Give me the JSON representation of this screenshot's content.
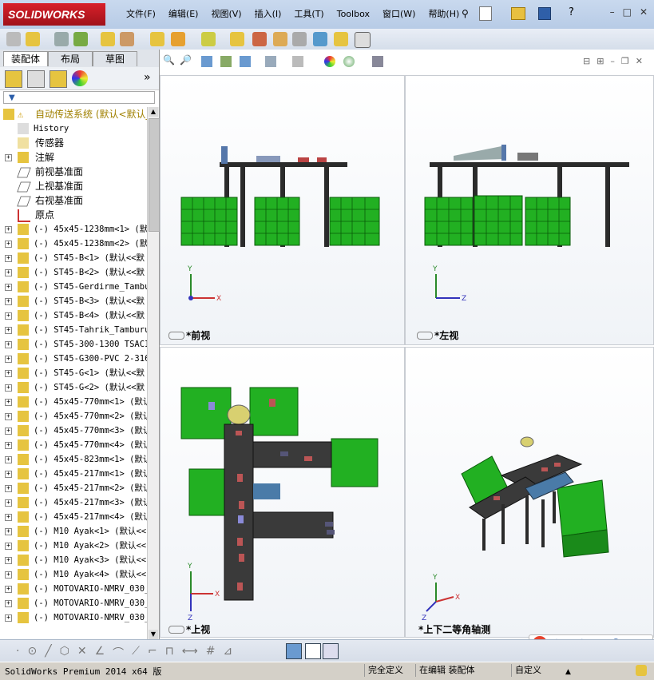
{
  "app": {
    "logo_text": "SOLIDWORKS",
    "menu": [
      "文件(F)",
      "编辑(E)",
      "视图(V)",
      "插入(I)",
      "工具(T)",
      "Toolbox",
      "窗口(W)",
      "帮助(H)"
    ],
    "window_controls": [
      "–",
      "□",
      "✕"
    ]
  },
  "panel": {
    "tabs": [
      "装配体",
      "布局",
      "草图"
    ],
    "expand_label": "»",
    "filter_label": "▼"
  },
  "tree": {
    "root": "自动传送系统  (默认<默认_",
    "items": [
      {
        "label": "History",
        "mono": true,
        "expand": false
      },
      {
        "label": "传感器",
        "mono": false,
        "expand": false
      },
      {
        "label": "注解",
        "mono": false,
        "expand": true
      },
      {
        "label": "前视基准面",
        "mono": false,
        "expand": false
      },
      {
        "label": "上视基准面",
        "mono": false,
        "expand": false
      },
      {
        "label": "右视基准面",
        "mono": false,
        "expand": false
      },
      {
        "label": "原点",
        "mono": false,
        "expand": false
      },
      {
        "label": "(-) 45x45-1238mm<1> (默",
        "mono": true,
        "expand": true
      },
      {
        "label": "(-) 45x45-1238mm<2> (默",
        "mono": true,
        "expand": true
      },
      {
        "label": "(-) ST45-B<1> (默认<<默",
        "mono": true,
        "expand": true
      },
      {
        "label": "(-) ST45-B<2> (默认<<默",
        "mono": true,
        "expand": true
      },
      {
        "label": "(-) ST45-Gerdirme_Tambu",
        "mono": true,
        "expand": true
      },
      {
        "label": "(-) ST45-B<3> (默认<<默",
        "mono": true,
        "expand": true
      },
      {
        "label": "(-) ST45-B<4> (默认<<默",
        "mono": true,
        "expand": true
      },
      {
        "label": "(-) ST45-Tahrik_Tamburu",
        "mono": true,
        "expand": true
      },
      {
        "label": "(-) ST45-300-1300 TSACI",
        "mono": true,
        "expand": true
      },
      {
        "label": "(-) ST45-G300-PVC 2-316",
        "mono": true,
        "expand": true
      },
      {
        "label": "(-) ST45-G<1> (默认<<默",
        "mono": true,
        "expand": true
      },
      {
        "label": "(-) ST45-G<2> (默认<<默",
        "mono": true,
        "expand": true
      },
      {
        "label": "(-) 45x45-770mm<1> (默认",
        "mono": true,
        "expand": true
      },
      {
        "label": "(-) 45x45-770mm<2> (默认",
        "mono": true,
        "expand": true
      },
      {
        "label": "(-) 45x45-770mm<3> (默认",
        "mono": true,
        "expand": true
      },
      {
        "label": "(-) 45x45-770mm<4> (默认",
        "mono": true,
        "expand": true
      },
      {
        "label": "(-) 45x45-823mm<1> (默认",
        "mono": true,
        "expand": true
      },
      {
        "label": "(-) 45x45-217mm<1> (默认",
        "mono": true,
        "expand": true
      },
      {
        "label": "(-) 45x45-217mm<2> (默认",
        "mono": true,
        "expand": true
      },
      {
        "label": "(-) 45x45-217mm<3> (默认",
        "mono": true,
        "expand": true
      },
      {
        "label": "(-) 45x45-217mm<4> (默认",
        "mono": true,
        "expand": true
      },
      {
        "label": "(-) M10 Ayak<1> (默认<<",
        "mono": true,
        "expand": true
      },
      {
        "label": "(-) M10 Ayak<2> (默认<<",
        "mono": true,
        "expand": true
      },
      {
        "label": "(-) M10 Ayak<3> (默认<<",
        "mono": true,
        "expand": true
      },
      {
        "label": "(-) M10 Ayak<4> (默认<<",
        "mono": true,
        "expand": true
      },
      {
        "label": "(-) MOTOVARIO-NMRV_030_",
        "mono": true,
        "expand": true
      },
      {
        "label": "(-) MOTOVARIO-NMRV_030_",
        "mono": true,
        "expand": true
      },
      {
        "label": "(-) MOTOVARIO-NMRV_030_",
        "mono": true,
        "expand": true
      }
    ]
  },
  "views": {
    "front": "*前视",
    "left": "*左视",
    "top": "*上视",
    "iso": "*上下二等角轴测"
  },
  "axes": {
    "x": "X",
    "y": "Y",
    "z": "Z"
  },
  "status": {
    "product": "SolidWorks Premium 2014 x64 版",
    "state": "完全定义",
    "mode": "在编辑 装配体",
    "custom": "自定义"
  },
  "ime": {
    "brand": "S",
    "lang": "中"
  },
  "colors": {
    "frame": "#2b2b2b",
    "crate": "#22b022",
    "belt": "#3a3a3a"
  }
}
